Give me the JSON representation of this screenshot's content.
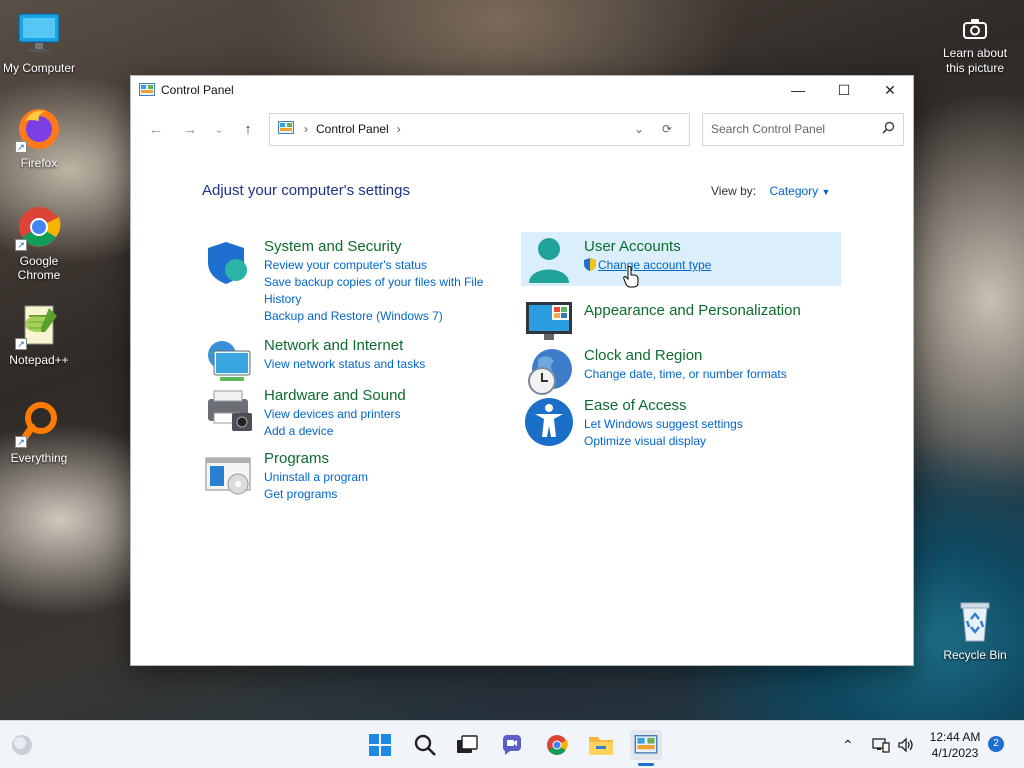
{
  "desktop": {
    "icons": [
      {
        "label": "My Computer",
        "icon": "computer-icon"
      },
      {
        "label": "Firefox",
        "icon": "firefox-icon"
      },
      {
        "label": "Google Chrome",
        "icon": "chrome-icon"
      },
      {
        "label": "Notepad++",
        "icon": "notepadpp-icon"
      },
      {
        "label": "Everything",
        "icon": "everything-icon"
      },
      {
        "label": "Recycle Bin",
        "icon": "recycle-bin-icon"
      }
    ],
    "learn_about": "Learn about this picture"
  },
  "window": {
    "title": "Control Panel",
    "breadcrumb": "Control Panel",
    "search_placeholder": "Search Control Panel",
    "heading": "Adjust your computer's settings",
    "view_by_label": "View by:",
    "view_by_value": "Category",
    "categories": [
      {
        "title": "System and Security",
        "icon": "shield-icon",
        "links": [
          "Review your computer's status",
          "Save backup copies of your files with File History",
          "Backup and Restore (Windows 7)"
        ]
      },
      {
        "title": "Network and Internet",
        "icon": "network-icon",
        "links": [
          "View network status and tasks"
        ]
      },
      {
        "title": "Hardware and Sound",
        "icon": "printer-icon",
        "links": [
          "View devices and printers",
          "Add a device"
        ]
      },
      {
        "title": "Programs",
        "icon": "programs-icon",
        "links": [
          "Uninstall a program",
          "Get programs"
        ]
      },
      {
        "title": "User Accounts",
        "icon": "user-icon",
        "links": [
          "Change account type"
        ]
      },
      {
        "title": "Appearance and Personalization",
        "icon": "monitor-palette-icon",
        "links": []
      },
      {
        "title": "Clock and Region",
        "icon": "clock-globe-icon",
        "links": [
          "Change date, time, or number formats"
        ]
      },
      {
        "title": "Ease of Access",
        "icon": "accessibility-icon",
        "links": [
          "Let Windows suggest settings",
          "Optimize visual display"
        ]
      }
    ]
  },
  "taskbar": {
    "time": "12:44 AM",
    "date": "4/1/2023",
    "notifications": "2"
  },
  "colors": {
    "link": "#0066cc",
    "category_title": "#0e6b2f",
    "heading": "#1e3287",
    "highlight": "#dbeefb"
  }
}
